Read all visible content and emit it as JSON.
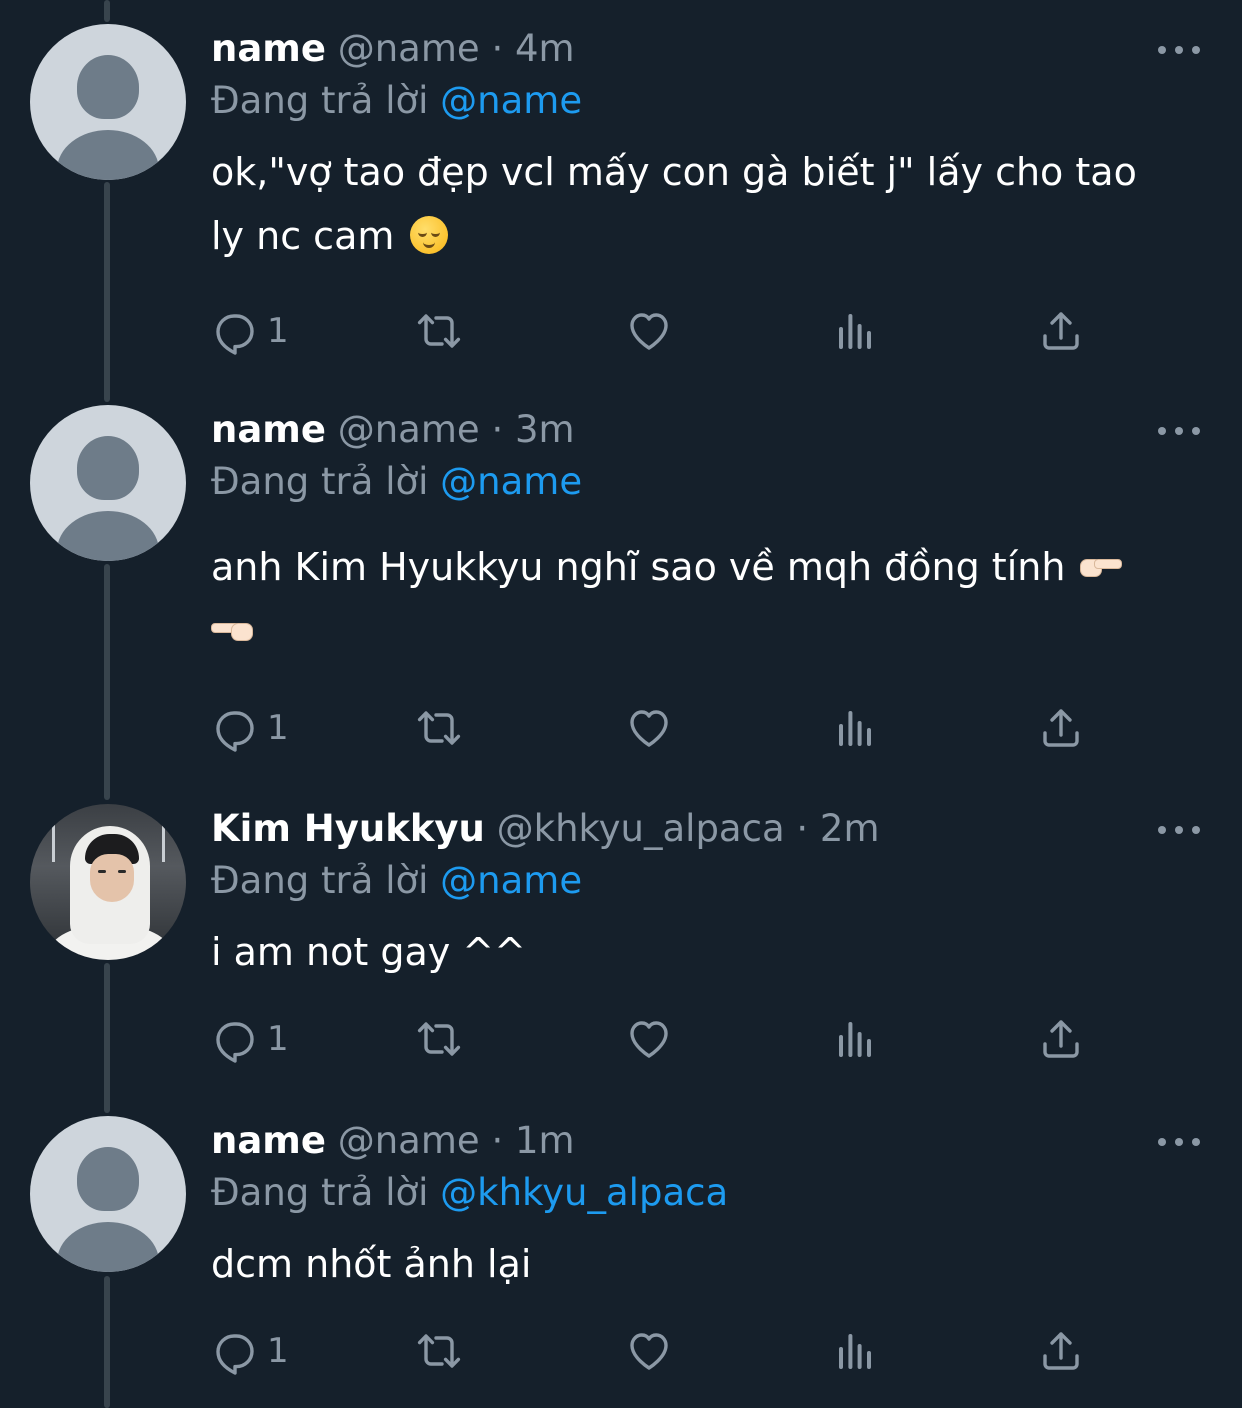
{
  "reply_label": "Đang trả lời",
  "tweets": [
    {
      "name": "name",
      "handle": "@name",
      "separator": "·",
      "time": "4m",
      "reply_to": "@name",
      "text_line1": "ok,\"vợ tao đẹp vcl mấy con gà biết j\" lấy cho tao",
      "text_line2": "ly nc cam",
      "emoji": "relieved-face",
      "reply_count": "1",
      "avatar": "default-avatar"
    },
    {
      "name": "name",
      "handle": "@name",
      "separator": "·",
      "time": "3m",
      "reply_to": "@name",
      "text_line1": "anh Kim Hyukkyu nghĩ sao về mqh đồng tính",
      "text_line2": "",
      "emoji": "pointing-hands",
      "reply_count": "1",
      "avatar": "default-avatar"
    },
    {
      "name": "Kim Hyukkyu",
      "handle": "@khkyu_alpaca",
      "separator": "·",
      "time": "2m",
      "reply_to": "@name",
      "text_line1": "i am not gay ^^",
      "text_line2": "",
      "reply_count": "1",
      "avatar": "photo-avatar"
    },
    {
      "name": "name",
      "handle": "@name",
      "separator": "·",
      "time": "1m",
      "reply_to": "@khkyu_alpaca",
      "text_line1": "dcm nhốt ảnh lại",
      "text_line2": "",
      "reply_count": "1",
      "avatar": "default-avatar"
    }
  ],
  "icons": {
    "reply": "reply-icon",
    "retweet": "retweet-icon",
    "like": "heart-icon",
    "views": "views-icon",
    "share": "share-icon",
    "more": "more-options-icon"
  },
  "colors": {
    "background": "#15202b",
    "text": "#ffffff",
    "muted": "#8b98a5",
    "accent": "#1d9bf0",
    "thread_line": "#38444d"
  }
}
